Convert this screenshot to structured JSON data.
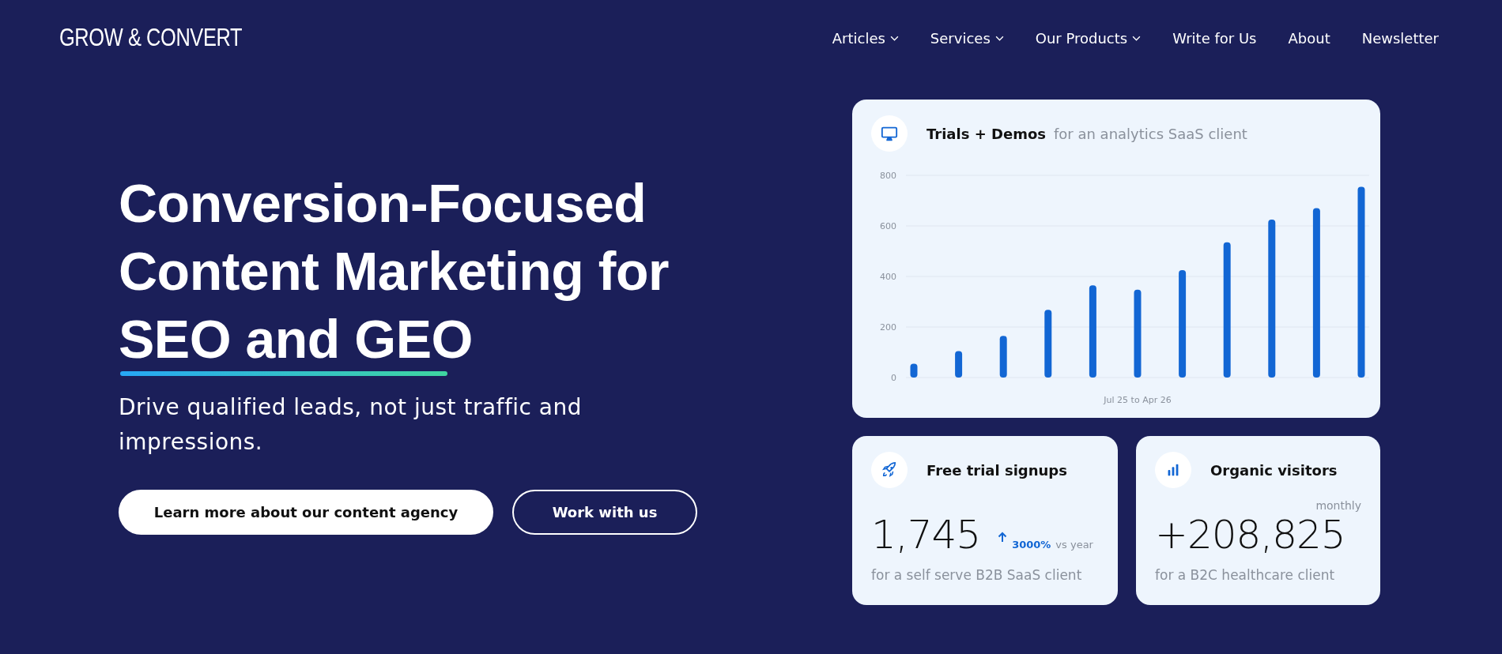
{
  "logo": "GROW & CONVERT",
  "nav": [
    {
      "label": "Articles",
      "dropdown": true
    },
    {
      "label": "Services",
      "dropdown": true
    },
    {
      "label": "Our Products",
      "dropdown": true
    },
    {
      "label": "Write for Us",
      "dropdown": false
    },
    {
      "label": "About",
      "dropdown": false
    },
    {
      "label": "Newsletter",
      "dropdown": false
    }
  ],
  "hero": {
    "headline": "Conversion-Focused Content Marketing for",
    "highlight": "SEO and GEO",
    "subtitle": "Drive qualified leads, not just traffic and impressions.",
    "buttons": [
      {
        "label": "Learn more about our content agency",
        "kind": "primary"
      },
      {
        "label": "Work with us",
        "kind": "outline"
      }
    ]
  },
  "chart_card": {
    "title": "Trials + Demos",
    "subtitle": "for an analytics SaaS client",
    "chart_data": {
      "type": "bar",
      "xlabel": "Jul 25 to Apr 26",
      "ylim": [
        0,
        800
      ],
      "yticks": [
        0,
        200,
        400,
        600,
        800
      ],
      "grid": true,
      "values": [
        55,
        105,
        165,
        268,
        365,
        348,
        425,
        535,
        625,
        670,
        755
      ]
    }
  },
  "stat_cards": [
    {
      "title": "Free trial signups",
      "value": "1,745",
      "change": "3000%",
      "change_note": "vs year",
      "caption": "for a self serve B2B SaaS client"
    },
    {
      "title": "Organic visitors",
      "period": "monthly",
      "value": "+208,825",
      "caption": "for a B2C healthcare client"
    }
  ]
}
